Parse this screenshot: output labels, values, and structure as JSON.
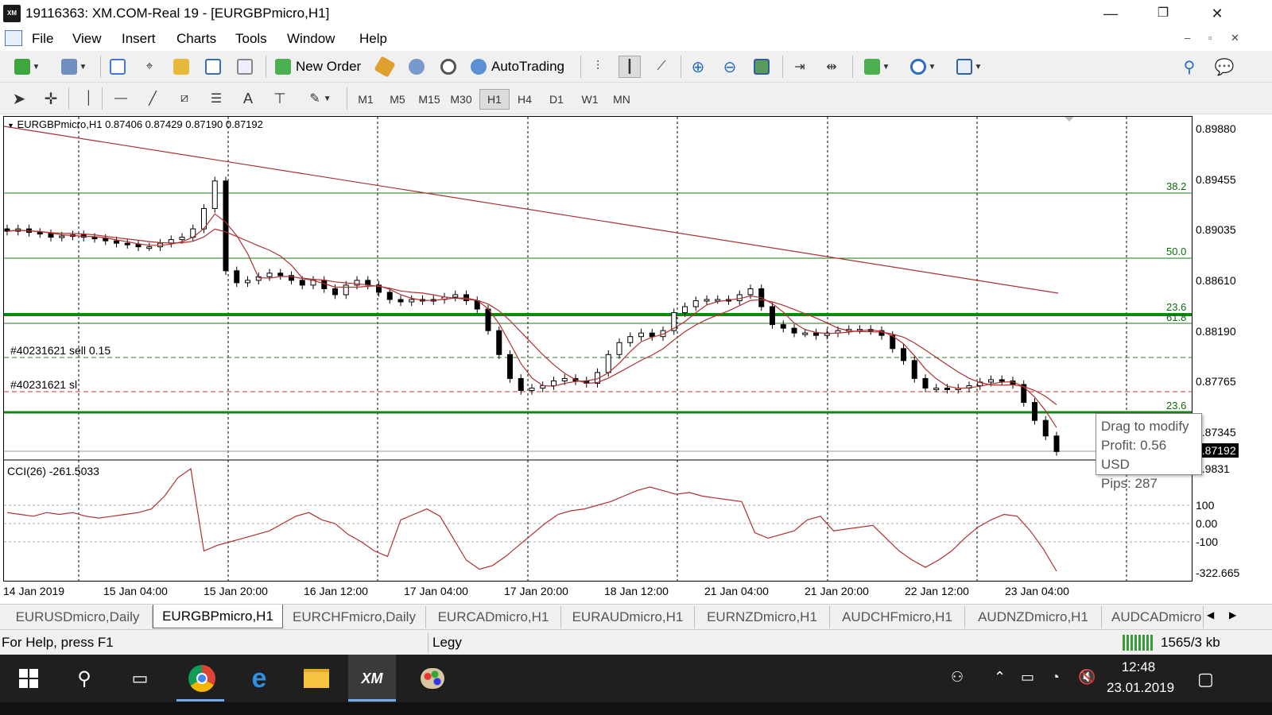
{
  "window": {
    "title": "19116363: XM.COM-Real 19 - [EURGBPmicro,H1]",
    "logo_text": "XM",
    "minimize": "—",
    "restore": "❐",
    "close": "✕"
  },
  "menu": {
    "items": [
      "File",
      "View",
      "Insert",
      "Charts",
      "Tools",
      "Window",
      "Help"
    ],
    "mdi_min": "–",
    "mdi_restore": "▫",
    "mdi_close": "✕"
  },
  "toolbar": {
    "new_order": "New Order",
    "autotrading": "AutoTrading"
  },
  "timeframes": [
    "M1",
    "M5",
    "M15",
    "M30",
    "H1",
    "H4",
    "D1",
    "W1",
    "MN"
  ],
  "active_timeframe": "H1",
  "chart": {
    "header": "EURGBPmicro,H1  0.87406 0.87429 0.87190 0.87192",
    "price_labels": [
      "0.89880",
      "0.89455",
      "0.89035",
      "0.88610",
      "0.88190",
      "0.87765",
      "0.87345"
    ],
    "current_price": "0.87192",
    "fib_labels": [
      "38.2",
      "50.0",
      "23.6",
      "61.8",
      "23.6"
    ],
    "order_sell": "#40231621 sell 0.15",
    "order_sl": "#40231621 sl",
    "tooltip": {
      "line1": "Drag to modify",
      "line2": "Profit: 0.56 USD",
      "line3": "Pips: 287"
    },
    "indicator_header": "CCI(26) -261.5033",
    "indicator_scale": [
      "0.9831",
      "100",
      "0.00",
      "-100",
      "-322.665"
    ],
    "x_labels": [
      "14 Jan 2019",
      "15 Jan 04:00",
      "15 Jan 20:00",
      "16 Jan 12:00",
      "17 Jan 04:00",
      "17 Jan 20:00",
      "18 Jan 12:00",
      "21 Jan 04:00",
      "21 Jan 20:00",
      "22 Jan 12:00",
      "23 Jan 04:00"
    ]
  },
  "chart_data": {
    "type": "candlestick",
    "symbol": "EURGBPmicro",
    "timeframe": "H1",
    "ohlc_last": {
      "open": 0.87406,
      "high": 0.87429,
      "low": 0.8719,
      "close": 0.87192
    },
    "close_approx": [
      0.8903,
      0.8905,
      0.8902,
      0.8901,
      0.8898,
      0.8899,
      0.89,
      0.8898,
      0.8897,
      0.8895,
      0.8893,
      0.8892,
      0.889,
      0.889,
      0.8893,
      0.8896,
      0.8898,
      0.8905,
      0.8922,
      0.8945,
      0.887,
      0.886,
      0.8862,
      0.8865,
      0.8868,
      0.8866,
      0.8862,
      0.8858,
      0.8862,
      0.8855,
      0.885,
      0.8858,
      0.8862,
      0.8858,
      0.8852,
      0.8846,
      0.8844,
      0.8846,
      0.8845,
      0.8846,
      0.8848,
      0.885,
      0.8845,
      0.8838,
      0.882,
      0.88,
      0.878,
      0.877,
      0.8772,
      0.8774,
      0.8778,
      0.878,
      0.8778,
      0.8776,
      0.8785,
      0.88,
      0.881,
      0.8815,
      0.8818,
      0.8815,
      0.882,
      0.8835,
      0.884,
      0.8845,
      0.8846,
      0.8846,
      0.8845,
      0.885,
      0.8855,
      0.884,
      0.8825,
      0.8822,
      0.8818,
      0.8818,
      0.8816,
      0.8818,
      0.882,
      0.8821,
      0.8821,
      0.882,
      0.8816,
      0.8805,
      0.8795,
      0.878,
      0.8772,
      0.8772,
      0.8771,
      0.8772,
      0.8774,
      0.8777,
      0.8779,
      0.8778,
      0.8775,
      0.876,
      0.8745,
      0.8732,
      0.8719
    ],
    "cci_approx": [
      60,
      50,
      40,
      60,
      50,
      60,
      40,
      30,
      40,
      50,
      60,
      80,
      150,
      250,
      300,
      -150,
      -120,
      -100,
      -80,
      -60,
      -40,
      0,
      40,
      60,
      20,
      0,
      -60,
      -100,
      -150,
      -180,
      20,
      50,
      80,
      40,
      -80,
      -200,
      -250,
      -230,
      -180,
      -120,
      -60,
      0,
      50,
      70,
      80,
      100,
      120,
      150,
      180,
      200,
      180,
      160,
      170,
      150,
      140,
      130,
      120,
      -50,
      -80,
      -60,
      -40,
      20,
      40,
      -40,
      -30,
      -20,
      -10,
      -80,
      -150,
      -200,
      -240,
      -200,
      -150,
      -80,
      -20,
      20,
      50,
      40,
      -40,
      -140,
      -261
    ]
  },
  "tabs": [
    "EURUSDmicro,Daily",
    "EURGBPmicro,H1",
    "EURCHFmicro,Daily",
    "EURCADmicro,H1",
    "EURAUDmicro,H1",
    "EURNZDmicro,H1",
    "AUDCHFmicro,H1",
    "AUDNZDmicro,H1",
    "AUDCADmicro"
  ],
  "active_tab": "EURGBPmicro,H1",
  "status": {
    "help": "For Help, press F1",
    "profile": "Legy",
    "traffic": "1565/3 kb"
  },
  "taskbar": {
    "time": "12:48",
    "date": "23.01.2019",
    "xm": "XM"
  }
}
